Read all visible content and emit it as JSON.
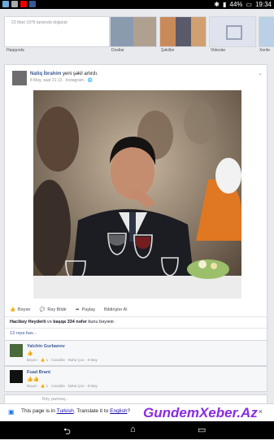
{
  "status_bar": {
    "battery": "44%",
    "time": "19:34"
  },
  "profile": {
    "about_text": "23 Mart 1976 tarixində doğulub",
    "tabs": [
      "Haqqında",
      "Dostlar",
      "Şəkillər",
      "Videolar",
      "Xerite"
    ]
  },
  "post": {
    "author": "Natiq İbrahim",
    "action": "yeni şəkil artırdı.",
    "meta": "8 May, saat 21:13 · Instagram · ",
    "actions": [
      "Bəyən",
      "Rəy Bildir",
      "Paylaş",
      "Bildirişlər Al"
    ],
    "likes_name": "Hacibey Heyderli",
    "likes_mid": "və",
    "likes_count": "başqa 334 nəfər",
    "likes_tail": "bunu bəyənir.",
    "shares": "13 rəya bax..."
  },
  "comments": [
    {
      "name": "Yalchin Gurbanov",
      "meta": "Bəyən · 👍 1 · Cavablə · Daha Çox · 8 May"
    },
    {
      "name": "Fuad Brant",
      "meta": "Bəyən · 👍 1 · Cavablə · Daha Çox · 8 May"
    }
  ],
  "write_placeholder": "Rəy yazmaq...",
  "translate_bar": {
    "prefix": "This page is in",
    "language": "Turkish",
    "middle": ". Translate it to",
    "target": "English",
    "suffix": "?"
  },
  "watermark": "GundemXeber.Az"
}
